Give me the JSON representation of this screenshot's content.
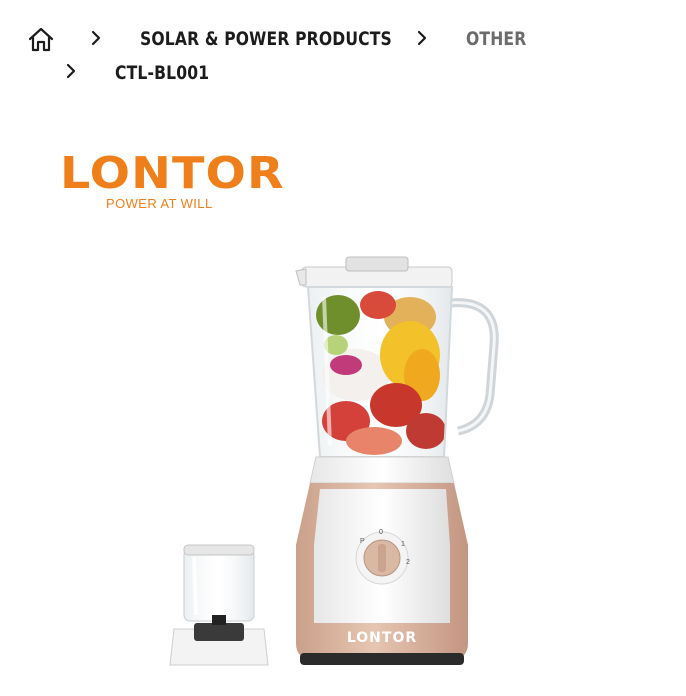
{
  "breadcrumb": {
    "home_icon": "home-icon",
    "separator_icon": "chevron-right-icon",
    "items": [
      {
        "label": "SOLAR & POWER PRODUCTS"
      },
      {
        "label": "OTHER"
      },
      {
        "label": "CTL-BL001"
      }
    ]
  },
  "brand": {
    "logo_text": "LONTOR",
    "tagline": "POWER AT WILL",
    "color": "#ef7f1a"
  },
  "product": {
    "image": "blender-with-grinder-cup",
    "base_logo_text": "LONTOR",
    "dial_labels": [
      "P",
      "0",
      "1",
      "2"
    ],
    "base_color": "#d9b29a"
  }
}
